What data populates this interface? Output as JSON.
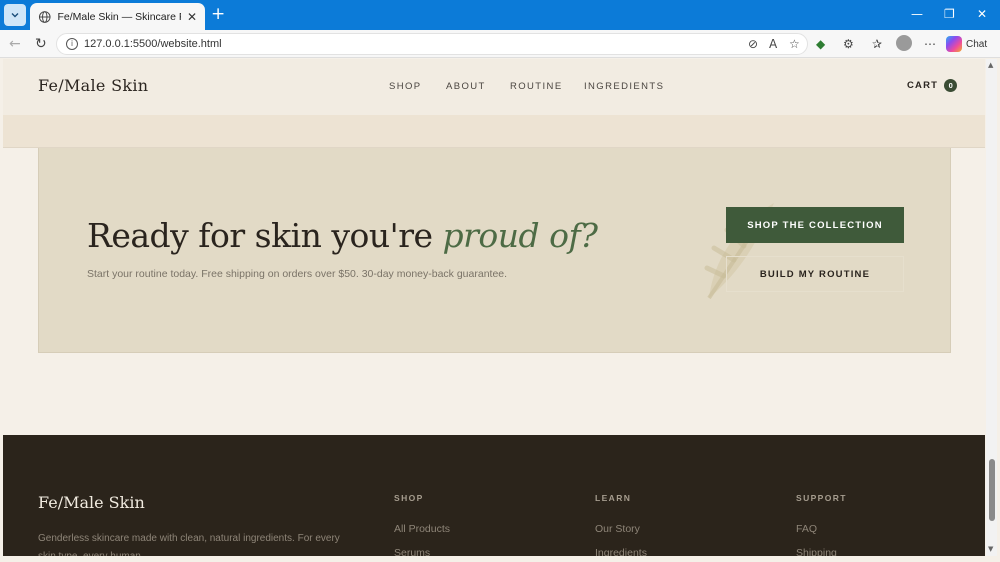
{
  "browser": {
    "tab_title": "Fe/Male Skin — Skincare For Every",
    "url": "127.0.0.1:5500/website.html",
    "chat_label": "Chat"
  },
  "header": {
    "brand": "Fe/Male Skin",
    "nav": [
      "SHOP",
      "ABOUT",
      "ROUTINE",
      "INGREDIENTS"
    ],
    "cart_label": "CART",
    "cart_count": "0"
  },
  "cta": {
    "headline_main": "Ready for skin you're ",
    "headline_em": "proud of?",
    "subtext": "Start your routine today. Free shipping on orders over $50. 30-day money-back guarantee.",
    "primary_button": "SHOP THE COLLECTION",
    "secondary_button": "BUILD MY ROUTINE",
    "accent_color": "#4d6b45"
  },
  "footer": {
    "brand": "Fe/Male Skin",
    "description": "Genderless skincare made with clean, natural ingredients. For every skin type, every human.",
    "columns": [
      {
        "heading": "SHOP",
        "links": [
          "All Products",
          "Serums"
        ]
      },
      {
        "heading": "LEARN",
        "links": [
          "Our Story",
          "Ingredients"
        ]
      },
      {
        "heading": "SUPPORT",
        "links": [
          "FAQ",
          "Shipping"
        ]
      }
    ]
  }
}
